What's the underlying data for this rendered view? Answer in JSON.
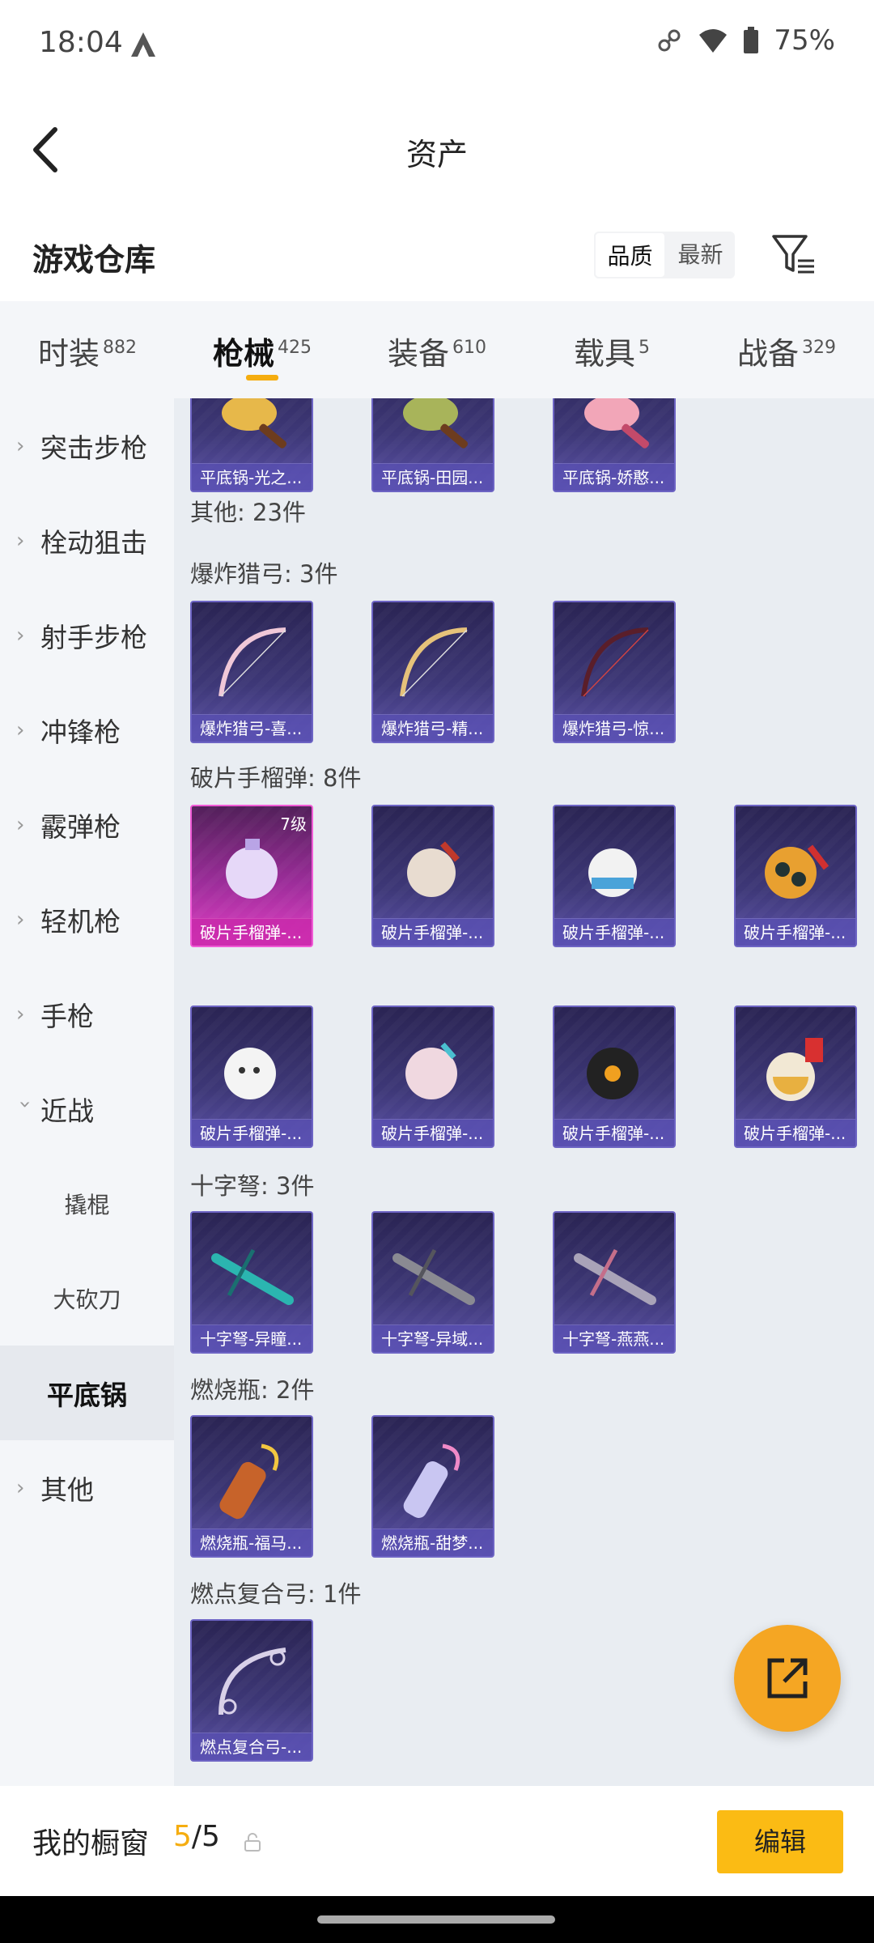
{
  "status_bar": {
    "time": "18:04",
    "battery": "75%"
  },
  "header": {
    "title": "资产"
  },
  "warehouse": {
    "title": "游戏仓库",
    "sort_options": [
      "品质",
      "最新"
    ]
  },
  "tabs": [
    {
      "label": "时装",
      "count": "882"
    },
    {
      "label": "枪械",
      "count": "425"
    },
    {
      "label": "装备",
      "count": "610"
    },
    {
      "label": "载具",
      "count": "5"
    },
    {
      "label": "战备",
      "count": "329"
    }
  ],
  "sidebar": {
    "items": [
      {
        "label": "突击步枪"
      },
      {
        "label": "栓动狙击"
      },
      {
        "label": "射手步枪"
      },
      {
        "label": "冲锋枪"
      },
      {
        "label": "霰弹枪"
      },
      {
        "label": "轻机枪"
      },
      {
        "label": "手枪"
      },
      {
        "label": "近战"
      },
      {
        "label": "撬棍"
      },
      {
        "label": "大砍刀"
      },
      {
        "label": "平底锅"
      },
      {
        "label": "其他"
      }
    ]
  },
  "groups": [
    {
      "title": "",
      "items": [
        "平底锅-光之...",
        "平底锅-田园...",
        "平底锅-娇憨..."
      ]
    },
    {
      "title": "其他: 23件",
      "items": []
    },
    {
      "title": "爆炸猎弓: 3件",
      "items": [
        "爆炸猎弓-喜...",
        "爆炸猎弓-精...",
        "爆炸猎弓-惊..."
      ]
    },
    {
      "title": "破片手榴弹: 8件",
      "items": [
        "破片手榴弹-...",
        "破片手榴弹-...",
        "破片手榴弹-...",
        "破片手榴弹-...",
        "破片手榴弹-...",
        "破片手榴弹-...",
        "破片手榴弹-...",
        "破片手榴弹-..."
      ],
      "first_level": "7级"
    },
    {
      "title": "十字弩: 3件",
      "items": [
        "十字弩-异瞳...",
        "十字弩-异域...",
        "十字弩-燕燕..."
      ]
    },
    {
      "title": "燃烧瓶: 2件",
      "items": [
        "燃烧瓶-福马...",
        "燃烧瓶-甜梦..."
      ]
    },
    {
      "title": "燃点复合弓: 1件",
      "items": [
        "燃点复合弓-..."
      ]
    }
  ],
  "showcase": {
    "label": "我的橱窗",
    "current": "5",
    "sep": "/",
    "total": "5",
    "edit": "编辑"
  },
  "colors": {
    "accent": "#f5ad10",
    "card_purple": "#3e3878",
    "card_pink": "#9c2d9a"
  }
}
